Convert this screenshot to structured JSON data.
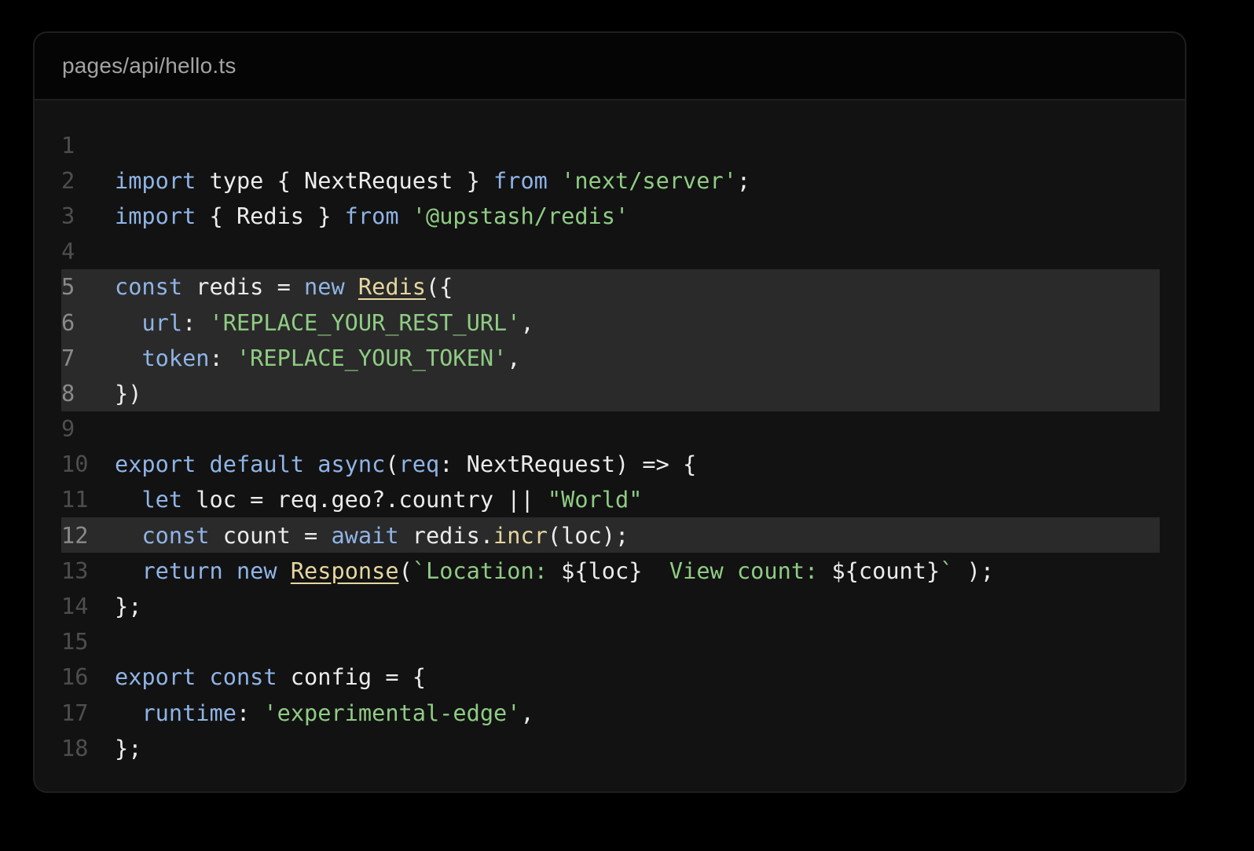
{
  "header": {
    "filename": "pages/api/hello.ts"
  },
  "code": {
    "highlighted_lines": [
      5,
      6,
      7,
      8,
      12
    ],
    "lines": [
      {
        "n": "1",
        "tokens": []
      },
      {
        "n": "2",
        "tokens": [
          {
            "t": "import",
            "c": "kw"
          },
          {
            "t": " type { NextRequest } ",
            "c": "pl"
          },
          {
            "t": "from",
            "c": "kw"
          },
          {
            "t": " ",
            "c": "pl"
          },
          {
            "t": "'next/server'",
            "c": "str"
          },
          {
            "t": ";",
            "c": "pl"
          }
        ]
      },
      {
        "n": "3",
        "tokens": [
          {
            "t": "import",
            "c": "kw"
          },
          {
            "t": " { Redis } ",
            "c": "pl"
          },
          {
            "t": "from",
            "c": "kw"
          },
          {
            "t": " ",
            "c": "pl"
          },
          {
            "t": "'@upstash/redis'",
            "c": "str"
          }
        ]
      },
      {
        "n": "4",
        "tokens": []
      },
      {
        "n": "5",
        "tokens": [
          {
            "t": "const",
            "c": "kw"
          },
          {
            "t": " redis = ",
            "c": "pl"
          },
          {
            "t": "new",
            "c": "kw"
          },
          {
            "t": " ",
            "c": "pl"
          },
          {
            "t": "Redis",
            "c": "fn"
          },
          {
            "t": "({",
            "c": "pl"
          }
        ]
      },
      {
        "n": "6",
        "tokens": [
          {
            "t": "  ",
            "c": "pl"
          },
          {
            "t": "url",
            "c": "kw"
          },
          {
            "t": ": ",
            "c": "pl"
          },
          {
            "t": "'REPLACE_YOUR_REST_URL'",
            "c": "str"
          },
          {
            "t": ",",
            "c": "pl"
          }
        ]
      },
      {
        "n": "7",
        "tokens": [
          {
            "t": "  ",
            "c": "pl"
          },
          {
            "t": "token",
            "c": "kw"
          },
          {
            "t": ": ",
            "c": "pl"
          },
          {
            "t": "'REPLACE_YOUR_TOKEN'",
            "c": "str"
          },
          {
            "t": ",",
            "c": "pl"
          }
        ]
      },
      {
        "n": "8",
        "tokens": [
          {
            "t": "})",
            "c": "pl"
          }
        ]
      },
      {
        "n": "9",
        "tokens": []
      },
      {
        "n": "10",
        "tokens": [
          {
            "t": "export",
            "c": "kw"
          },
          {
            "t": " ",
            "c": "pl"
          },
          {
            "t": "default",
            "c": "kw"
          },
          {
            "t": " ",
            "c": "pl"
          },
          {
            "t": "async",
            "c": "kw"
          },
          {
            "t": "(",
            "c": "pl"
          },
          {
            "t": "req",
            "c": "kw"
          },
          {
            "t": ": NextRequest) => {",
            "c": "pl"
          }
        ]
      },
      {
        "n": "11",
        "tokens": [
          {
            "t": "  ",
            "c": "pl"
          },
          {
            "t": "let",
            "c": "kw"
          },
          {
            "t": " loc = req.geo?.country || ",
            "c": "pl"
          },
          {
            "t": "\"World\"",
            "c": "str"
          }
        ]
      },
      {
        "n": "12",
        "tokens": [
          {
            "t": "  ",
            "c": "pl"
          },
          {
            "t": "const",
            "c": "kw"
          },
          {
            "t": " count = ",
            "c": "pl"
          },
          {
            "t": "await",
            "c": "kw"
          },
          {
            "t": " redis.",
            "c": "pl"
          },
          {
            "t": "incr",
            "c": "fnc"
          },
          {
            "t": "(loc);",
            "c": "pl"
          }
        ]
      },
      {
        "n": "13",
        "tokens": [
          {
            "t": "  ",
            "c": "pl"
          },
          {
            "t": "return",
            "c": "kw"
          },
          {
            "t": " ",
            "c": "pl"
          },
          {
            "t": "new",
            "c": "kw"
          },
          {
            "t": " ",
            "c": "pl"
          },
          {
            "t": "Response",
            "c": "fn"
          },
          {
            "t": "(",
            "c": "pl"
          },
          {
            "t": "`Location: ",
            "c": "str"
          },
          {
            "t": "${loc}",
            "c": "pl"
          },
          {
            "t": "  View count: ",
            "c": "str"
          },
          {
            "t": "${count}",
            "c": "pl"
          },
          {
            "t": "`",
            "c": "str"
          },
          {
            "t": " );",
            "c": "pl"
          }
        ]
      },
      {
        "n": "14",
        "tokens": [
          {
            "t": "};",
            "c": "pl"
          }
        ]
      },
      {
        "n": "15",
        "tokens": []
      },
      {
        "n": "16",
        "tokens": [
          {
            "t": "export",
            "c": "kw"
          },
          {
            "t": " ",
            "c": "pl"
          },
          {
            "t": "const",
            "c": "kw"
          },
          {
            "t": " config = {",
            "c": "pl"
          }
        ]
      },
      {
        "n": "17",
        "tokens": [
          {
            "t": "  ",
            "c": "pl"
          },
          {
            "t": "runtime",
            "c": "kw"
          },
          {
            "t": ": ",
            "c": "pl"
          },
          {
            "t": "'experimental-edge'",
            "c": "str"
          },
          {
            "t": ",",
            "c": "pl"
          }
        ]
      },
      {
        "n": "18",
        "tokens": [
          {
            "t": "};",
            "c": "pl"
          }
        ]
      }
    ]
  }
}
